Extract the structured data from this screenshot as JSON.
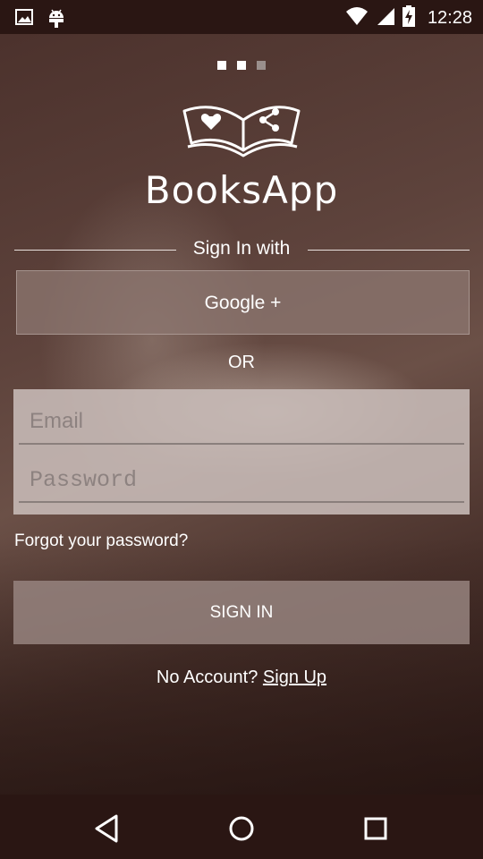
{
  "status_bar": {
    "time": "12:28",
    "icons": [
      "image-icon",
      "android-icon",
      "wifi-icon",
      "signal-icon",
      "battery-charging-icon"
    ]
  },
  "pager": {
    "count": 3,
    "active": 2
  },
  "brand": {
    "name": "BooksApp",
    "logo_icon": "open-book-heart-share-icon"
  },
  "signin_with": "Sign In with",
  "google_button": "Google +",
  "or_text": "OR",
  "email_field": {
    "placeholder": "Email",
    "value": ""
  },
  "password_field": {
    "placeholder": "Password",
    "value": ""
  },
  "forgot_password": "Forgot your password?",
  "signin_button": "SIGN IN",
  "no_account": {
    "text": "No Account?",
    "link": "Sign Up"
  },
  "nav_bar": {
    "icons": [
      "back-icon",
      "home-icon",
      "recents-icon"
    ]
  },
  "colors": {
    "status_bar": "#2a1613",
    "background": "#4a302b",
    "form_box": "#c8bcb8",
    "button": "#96847f",
    "text": "#ffffff"
  }
}
